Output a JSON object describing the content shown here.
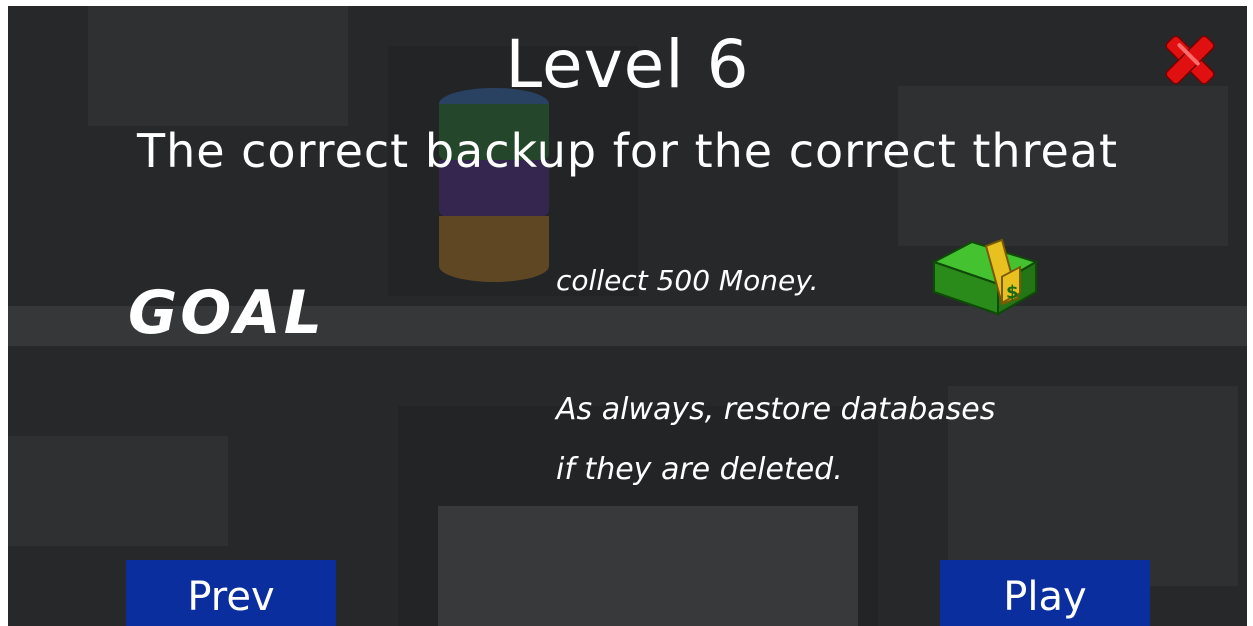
{
  "level": {
    "title": "Level 6",
    "subtitle": "The correct backup for the correct threat"
  },
  "goal": {
    "label": "GOAL",
    "objective": "collect 500 Money.",
    "reminder_line1": "As always, restore databases",
    "reminder_line2": "if they are deleted."
  },
  "buttons": {
    "prev_label": "Prev",
    "play_label": "Play"
  },
  "icons": {
    "close": "close-icon",
    "money": "money-stack-icon",
    "database": "database-icon"
  },
  "colors": {
    "overlay": "#26282a",
    "button": "#0a2e9e",
    "close": "#e01010",
    "money": "#2e9a1e",
    "band": "#e8c020"
  }
}
